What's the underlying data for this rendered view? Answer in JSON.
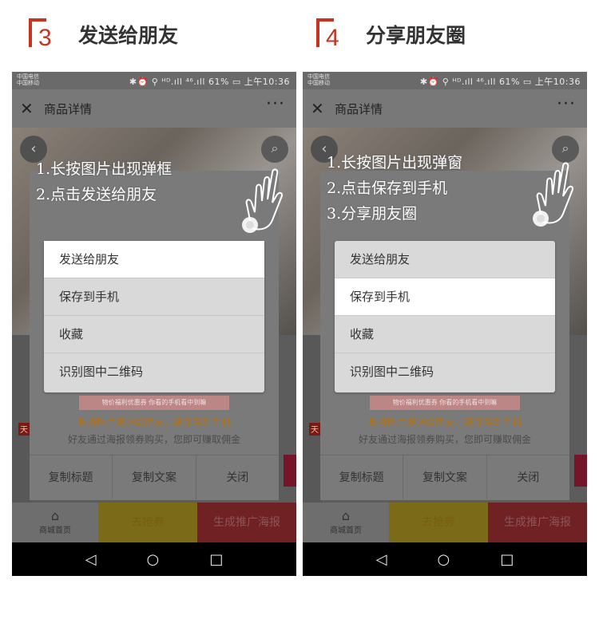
{
  "steps": [
    {
      "number": "3",
      "title": "发送给朋友",
      "phone": {
        "carrier": [
          "中国电信",
          "中国移动"
        ],
        "status_right": "✱⏰ ⚲ ᴴᴰ.ıll ⁴⁶.ıll 61% ▭ 上午10:36",
        "nav_title": "商品详情",
        "close_icon": "✕",
        "more_icon": "···",
        "instructions": [
          "1.长按图片出现弹框",
          "2.点击发送给朋友"
        ],
        "menu": [
          "发送给朋友",
          "保存到手机",
          "收藏",
          "识别图中二维码"
        ],
        "highlight_index": 0,
        "poster_strip": "物价福利优惠券  你看的手机看中到嘛",
        "hint1": "长按图片发送给朋友，或保存到手机",
        "hint2": "好友通过海报领券购买，您即可赚取佣金",
        "actions": [
          "复制标题",
          "复制文案",
          "关闭"
        ],
        "bottom": {
          "home": "商城首页",
          "coupon": "去抢券",
          "poster": "生成推广海报"
        }
      }
    },
    {
      "number": "4",
      "title": "分享朋友圈",
      "phone": {
        "carrier": [
          "中国电信",
          "中国移动"
        ],
        "status_right": "✱⏰ ⚲ ᴴᴰ.ıll ⁴⁶.ıll 61% ▭ 上午10:36",
        "nav_title": "商品详情",
        "close_icon": "✕",
        "more_icon": "···",
        "instructions": [
          "1.长按图片出现弹窗",
          "2.点击保存到手机",
          "3.分享朋友圈"
        ],
        "menu": [
          "发送给朋友",
          "保存到手机",
          "收藏",
          "识别图中二维码"
        ],
        "highlight_index": 1,
        "poster_strip": "物价福利优惠券  你看的手机看中到嘛",
        "hint1": "长按图片发送给朋友，或保存到手机",
        "hint2": "好友通过海报领券购买，您即可赚取佣金",
        "actions": [
          "复制标题",
          "复制文案",
          "关闭"
        ],
        "bottom": {
          "home": "商城首页",
          "coupon": "去抢券",
          "poster": "生成推广海报"
        }
      }
    }
  ],
  "system_nav": {
    "back": "◁",
    "home": "○",
    "recent": "□"
  },
  "colors": {
    "accent": "#c8321f",
    "hint_orange": "#b8710c"
  }
}
